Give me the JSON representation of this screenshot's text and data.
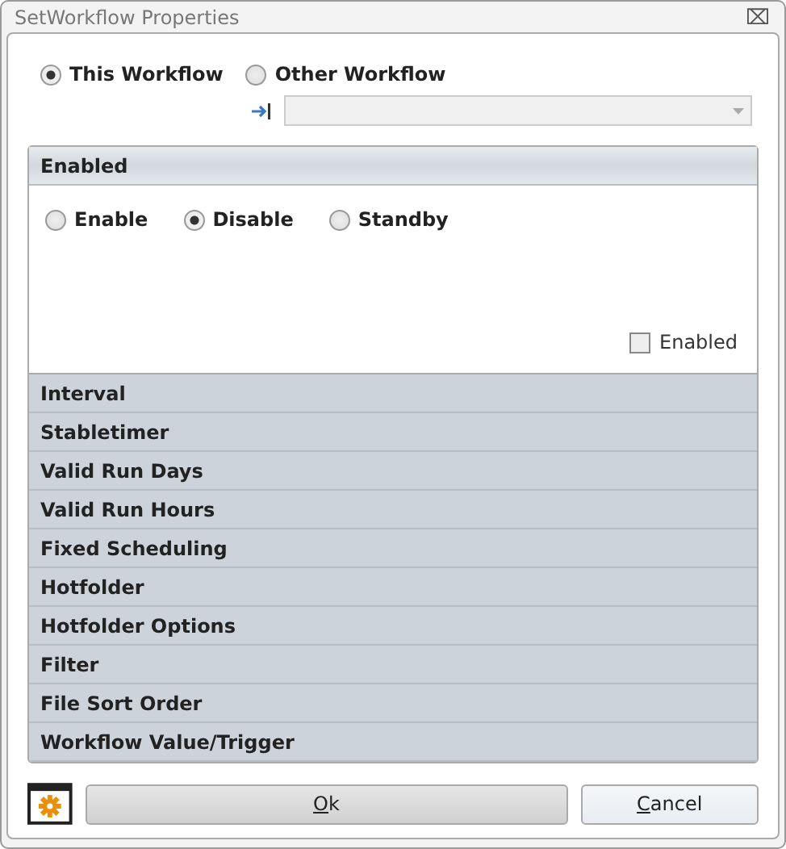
{
  "window": {
    "title": "SetWorkflow Properties",
    "close": "⌧"
  },
  "scope": [
    {
      "label": "This Workflow",
      "selected": true
    },
    {
      "label": "Other Workflow",
      "selected": false
    }
  ],
  "workflow_select": {
    "disabled": true
  },
  "sections": [
    {
      "title": "Enabled",
      "expanded": true,
      "options": [
        {
          "label": "Enable",
          "selected": false
        },
        {
          "label": "Disable",
          "selected": true
        },
        {
          "label": "Standby",
          "selected": false
        }
      ],
      "checkbox": {
        "label": "Enabled",
        "checked": false
      }
    },
    {
      "title": "Interval",
      "expanded": false
    },
    {
      "title": "Stabletimer",
      "expanded": false
    },
    {
      "title": "Valid Run Days",
      "expanded": false
    },
    {
      "title": "Valid Run Hours",
      "expanded": false
    },
    {
      "title": "Fixed Scheduling",
      "expanded": false
    },
    {
      "title": "Hotfolder",
      "expanded": false
    },
    {
      "title": "Hotfolder Options",
      "expanded": false
    },
    {
      "title": "Filter",
      "expanded": false
    },
    {
      "title": "File Sort Order",
      "expanded": false
    },
    {
      "title": "Workflow Value/Trigger",
      "expanded": false
    }
  ],
  "buttons": [
    {
      "label": "Ok",
      "kind": "primary"
    },
    {
      "label": "Cancel",
      "kind": "secondary"
    }
  ]
}
